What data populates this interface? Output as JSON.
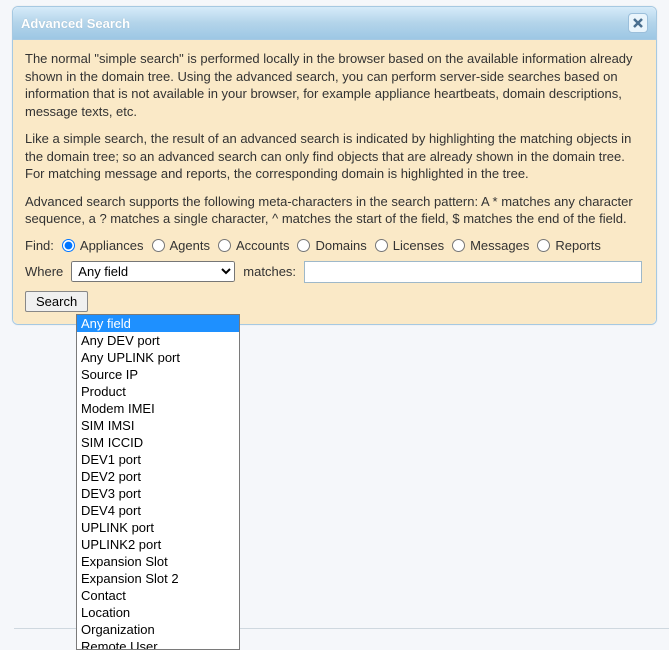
{
  "dialog": {
    "title": "Advanced Search",
    "para1": "The normal \"simple search\" is performed locally in the browser based on the available information already shown in the domain tree. Using the advanced search, you can perform server-side searches based on information that is not available in your browser, for example appliance heartbeats, domain descriptions, message texts, etc.",
    "para2": "Like a simple search, the result of an advanced search is indicated by highlighting the matching objects in the domain tree; so an advanced search can only find objects that are already shown in the domain tree. For matching message and reports, the corresponding domain is highlighted in the tree.",
    "para3": "Advanced search supports the following meta-characters in the search pattern: A * matches any character sequence, a ? matches a single character, ^ matches the start of the field, $ matches the end of the field.",
    "find_label": "Find:",
    "radios": [
      {
        "label": "Appliances",
        "checked": true
      },
      {
        "label": "Agents",
        "checked": false
      },
      {
        "label": "Accounts",
        "checked": false
      },
      {
        "label": "Domains",
        "checked": false
      },
      {
        "label": "Licenses",
        "checked": false
      },
      {
        "label": "Messages",
        "checked": false
      },
      {
        "label": "Reports",
        "checked": false
      }
    ],
    "where_label": "Where",
    "field_select_value": "Any field",
    "matches_label": "matches:",
    "search_value": "",
    "search_button": "Search",
    "dropdown_options": [
      "Any field",
      "Any DEV port",
      "Any UPLINK port",
      "Source IP",
      "Product",
      "Modem IMEI",
      "SIM IMSI",
      "SIM ICCID",
      "DEV1 port",
      "DEV2 port",
      "DEV3 port",
      "DEV4 port",
      "UPLINK port",
      "UPLINK2 port",
      "Expansion Slot",
      "Expansion Slot 2",
      "Contact",
      "Location",
      "Organization",
      "Remote User"
    ],
    "dropdown_selected_index": 0
  }
}
